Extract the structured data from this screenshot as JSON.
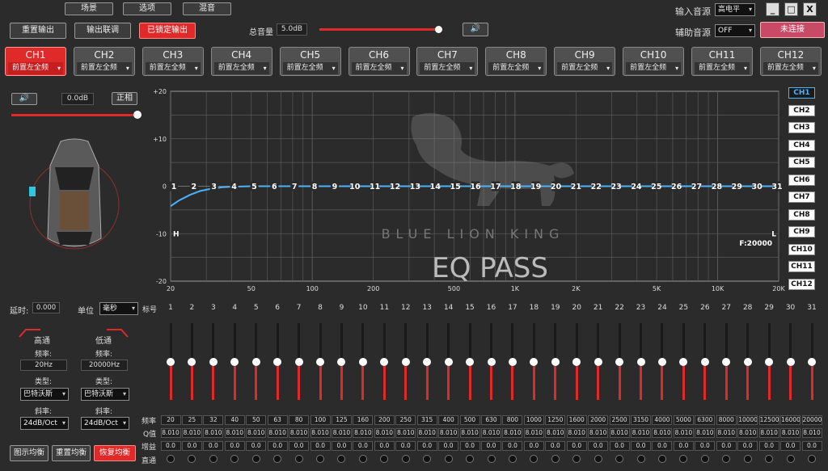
{
  "top_menu": [
    "场景",
    "选项",
    "混音"
  ],
  "input_source": {
    "label": "输入音源",
    "value": "高电平"
  },
  "aux_source": {
    "label": "辅助音源",
    "value": "OFF"
  },
  "connect_button": "未连接",
  "window_controls": [
    "_",
    "□",
    "X"
  ],
  "toolbar": {
    "reset_output": "重置输出",
    "output_link": "输出联调",
    "locked_output": "已锁定输出",
    "master_label": "总音量",
    "master_value": "5.0dB",
    "master_level": 0.97
  },
  "channel_source": "前置左全频",
  "channels": [
    "CH1",
    "CH2",
    "CH3",
    "CH4",
    "CH5",
    "CH6",
    "CH7",
    "CH8",
    "CH9",
    "CH10",
    "CH11",
    "CH12"
  ],
  "channel_panel": {
    "gain_value": "0.0dB",
    "phase_label": "正相",
    "volume_level": 1.0
  },
  "chart_data": {
    "type": "line",
    "y_ticks": [
      "+20",
      "+10",
      "0",
      "-10",
      "-20"
    ],
    "ylim": [
      -20,
      20
    ],
    "x_ticks": [
      "20",
      "50",
      "100",
      "200",
      "500",
      "1K",
      "2K",
      "5K",
      "10K",
      "20K"
    ],
    "x_tick_values": [
      20,
      50,
      100,
      200,
      500,
      1000,
      2000,
      5000,
      10000,
      20000
    ],
    "xlim": [
      20,
      20000
    ],
    "x_scale": "log",
    "band_markers": [
      "1",
      "2",
      "3",
      "4",
      "5",
      "6",
      "7",
      "8",
      "9",
      "10",
      "11",
      "12",
      "13",
      "14",
      "15",
      "16",
      "17",
      "18",
      "19",
      "20",
      "21",
      "22",
      "23",
      "24",
      "25",
      "26",
      "27",
      "28",
      "29",
      "30",
      "31"
    ],
    "curve": {
      "x": [
        20,
        22,
        25,
        28,
        32,
        36,
        40,
        50,
        63,
        80,
        100,
        1000,
        10000,
        20000
      ],
      "y": [
        -4.2,
        -3.0,
        -1.8,
        -1.0,
        -0.5,
        -0.2,
        -0.1,
        0,
        0,
        0,
        0,
        0,
        0,
        0
      ]
    },
    "high_pass_marker": "H",
    "low_pass_marker": "L",
    "freq_readout": "F:20000",
    "grid": true
  },
  "watermark": {
    "brand": "BLUE LION KING",
    "title": "EQ PASS"
  },
  "delay": {
    "label": "延时:",
    "value": "0.000",
    "unit_label": "单位",
    "unit_value": "毫秒",
    "marker": "标号"
  },
  "high_pass": {
    "title": "高通",
    "freq_label": "频率:",
    "freq": "20Hz",
    "type_label": "类型:",
    "type": "巴特沃斯",
    "slope_label": "斜率:",
    "slope": "24dB/Oct"
  },
  "low_pass": {
    "title": "低通",
    "freq_label": "频率:",
    "freq": "20000Hz",
    "type_label": "类型:",
    "type": "巴特沃斯",
    "slope_label": "斜率:",
    "slope": "24dB/Oct"
  },
  "bottom_buttons": [
    "图示均衡",
    "重置均衡",
    "恢复均衡"
  ],
  "band_labels": [
    "1",
    "2",
    "3",
    "4",
    "5",
    "6",
    "7",
    "8",
    "9",
    "10",
    "11",
    "12",
    "13",
    "14",
    "15",
    "16",
    "17",
    "18",
    "19",
    "20",
    "21",
    "22",
    "23",
    "24",
    "25",
    "26",
    "27",
    "28",
    "29",
    "30",
    "31"
  ],
  "row_labels": {
    "freq": "频率",
    "q": "Q值",
    "gain": "增益",
    "bypass": "直通"
  },
  "frequencies": [
    "20",
    "25",
    "32",
    "40",
    "50",
    "63",
    "80",
    "100",
    "125",
    "160",
    "200",
    "250",
    "315",
    "400",
    "500",
    "630",
    "800",
    "1000",
    "1250",
    "1600",
    "2000",
    "2500",
    "3150",
    "4000",
    "5000",
    "6300",
    "8000",
    "10000",
    "12500",
    "16000",
    "20000"
  ],
  "q_value": "8.010",
  "gain_value": "0.0",
  "band_gain_db": 0,
  "colors": {
    "accent_red": "#e02a2a",
    "curve": "#4ab3ff",
    "background": "#2b2b2b"
  }
}
